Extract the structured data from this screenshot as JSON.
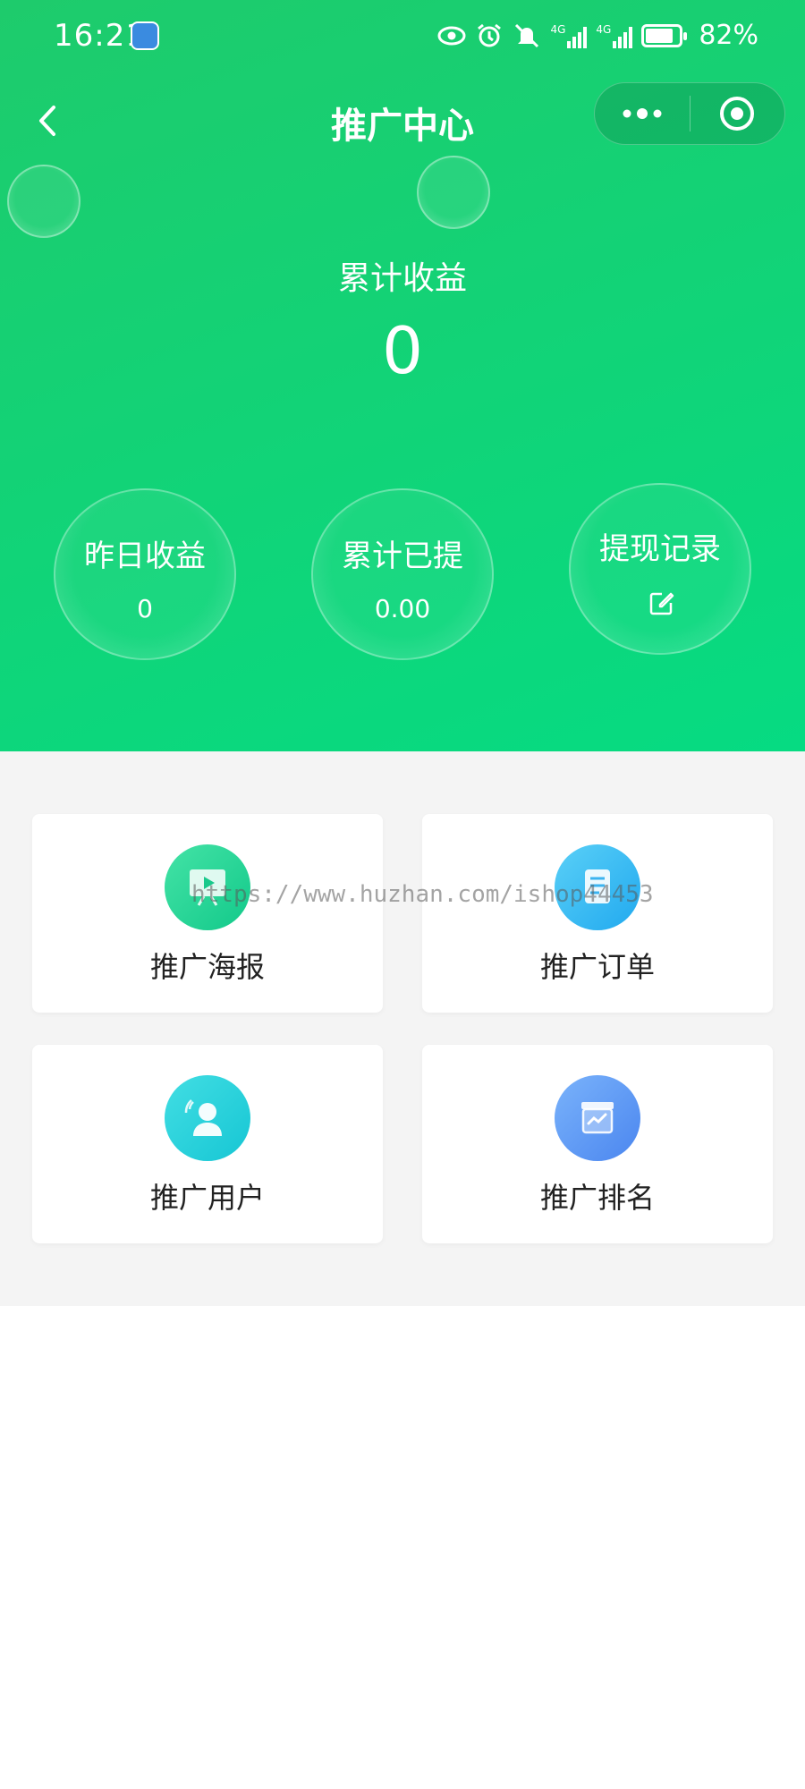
{
  "statusbar": {
    "time": "16:21",
    "battery_percent": "82%",
    "battery_level": 82,
    "icons": [
      "eye-icon",
      "alarm-icon",
      "mute-icon",
      "signal-4g-icon",
      "signal-4g-icon",
      "battery-icon"
    ],
    "network_label_1": "4G",
    "network_label_2": "4G"
  },
  "navbar": {
    "title": "推广中心",
    "back_icon": "chevron-left-icon",
    "more_icon": "more-dots-icon",
    "close_icon": "target-circle-icon"
  },
  "earnings": {
    "total_label": "累计收益",
    "total_value": "0"
  },
  "stats": [
    {
      "label": "昨日收益",
      "value": "0"
    },
    {
      "label": "累计已提",
      "value": "0.00"
    },
    {
      "label": "提现记录",
      "icon": "edit-icon"
    }
  ],
  "menu": [
    {
      "label": "推广海报",
      "icon": "poster-icon",
      "color_from": "#44e3a6",
      "color_to": "#12c98a"
    },
    {
      "label": "推广订单",
      "icon": "order-icon",
      "color_from": "#5ad0f7",
      "color_to": "#21a9ef"
    },
    {
      "label": "推广用户",
      "icon": "user-icon",
      "color_from": "#42dee3",
      "color_to": "#16c6d4"
    },
    {
      "label": "推广排名",
      "icon": "ranking-icon",
      "color_from": "#7ab3fb",
      "color_to": "#4b86ef"
    }
  ],
  "watermark": "https://www.huzhan.com/ishop44453",
  "colors": {
    "primary": "#06db82",
    "background": "#f4f4f4"
  }
}
